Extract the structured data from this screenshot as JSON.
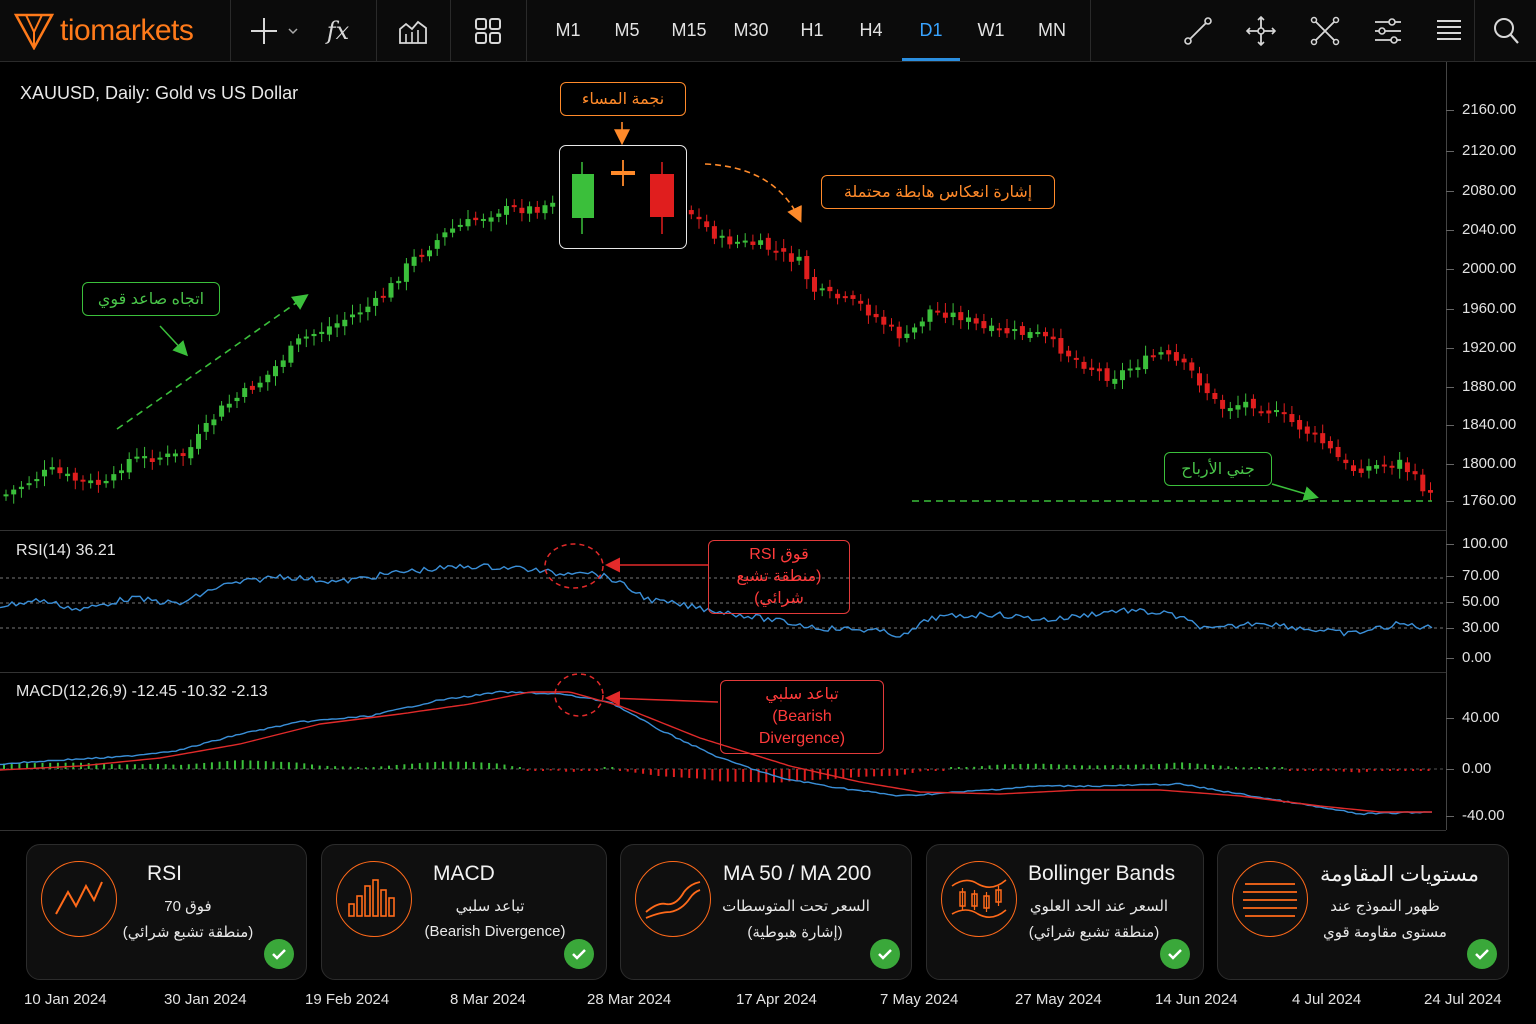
{
  "logo": {
    "part1": "tio",
    "part2": "markets"
  },
  "toolbar": {
    "timeframes": [
      "M1",
      "M5",
      "M15",
      "M30",
      "H1",
      "H4",
      "D1",
      "W1",
      "MN"
    ],
    "active_timeframe": "D1",
    "fx_label": "fx"
  },
  "chart": {
    "title": "XAUUSD, Daily:  Gold vs US Dollar",
    "price_ticks": [
      "2160.00",
      "2120.00",
      "2080.00",
      "2040.00",
      "2000.00",
      "1960.00",
      "1920.00",
      "1880.00",
      "1840.00",
      "1800.00",
      "1760.00"
    ],
    "rsi_label": "RSI(14) 36.21",
    "rsi_ticks": [
      "100.00",
      "70.00",
      "50.00",
      "30.00",
      "0.00"
    ],
    "macd_label": "MACD(12,26,9)  -12.45  -10.32  -2.13",
    "macd_ticks": [
      "40.00",
      "0.00",
      "-40.00"
    ],
    "dates": [
      "10 Jan 2024",
      "30 Jan 2024",
      "19 Feb 2024",
      "8 Mar 2024",
      "28 Mar 2024",
      "17 Apr 2024",
      "7 May 2024",
      "27 May 2024",
      "14 Jun 2024",
      "4 Jul 2024",
      "24 Jul 2024"
    ]
  },
  "annotations": {
    "evening_star": "نجمة المساء",
    "bearish_reversal": "إشارة انعكاس هابطة محتملة",
    "strong_uptrend": "اتجاه صاعد قوي",
    "profit_taking": "جني الأرباح",
    "rsi_line1": "قوق RSI",
    "rsi_line2": "(منطقة تشبع شرائي)",
    "macd_line1": "تباعد سلبي",
    "macd_line2": "(Bearish Divergence)"
  },
  "cards": [
    {
      "title": "RSI",
      "line1": "فوق 70",
      "line2": "(منطقة تشبع شرائي)"
    },
    {
      "title": "MACD",
      "line1": "تباعد سلبي",
      "line2": "(Bearish Divergence)"
    },
    {
      "title": "MA 50 / MA 200",
      "line1": "السعر تحت المتوسطات",
      "line2": "(إشارة هبوطية)"
    },
    {
      "title": "Bollinger Bands",
      "line1": "السعر عند الحد العلوي",
      "line2": "(منطقة تشبع شرائي)"
    },
    {
      "title": "مستويات المقاومة",
      "line1": "ظهور النموذج عند",
      "line2": "مستوى مقاومة قوي"
    }
  ],
  "colors": {
    "accent": "#ff7a1a",
    "bull": "#3bbf3b",
    "bear": "#e01e1e",
    "active_tf": "#38a3ff",
    "check": "#3aa83a"
  }
}
